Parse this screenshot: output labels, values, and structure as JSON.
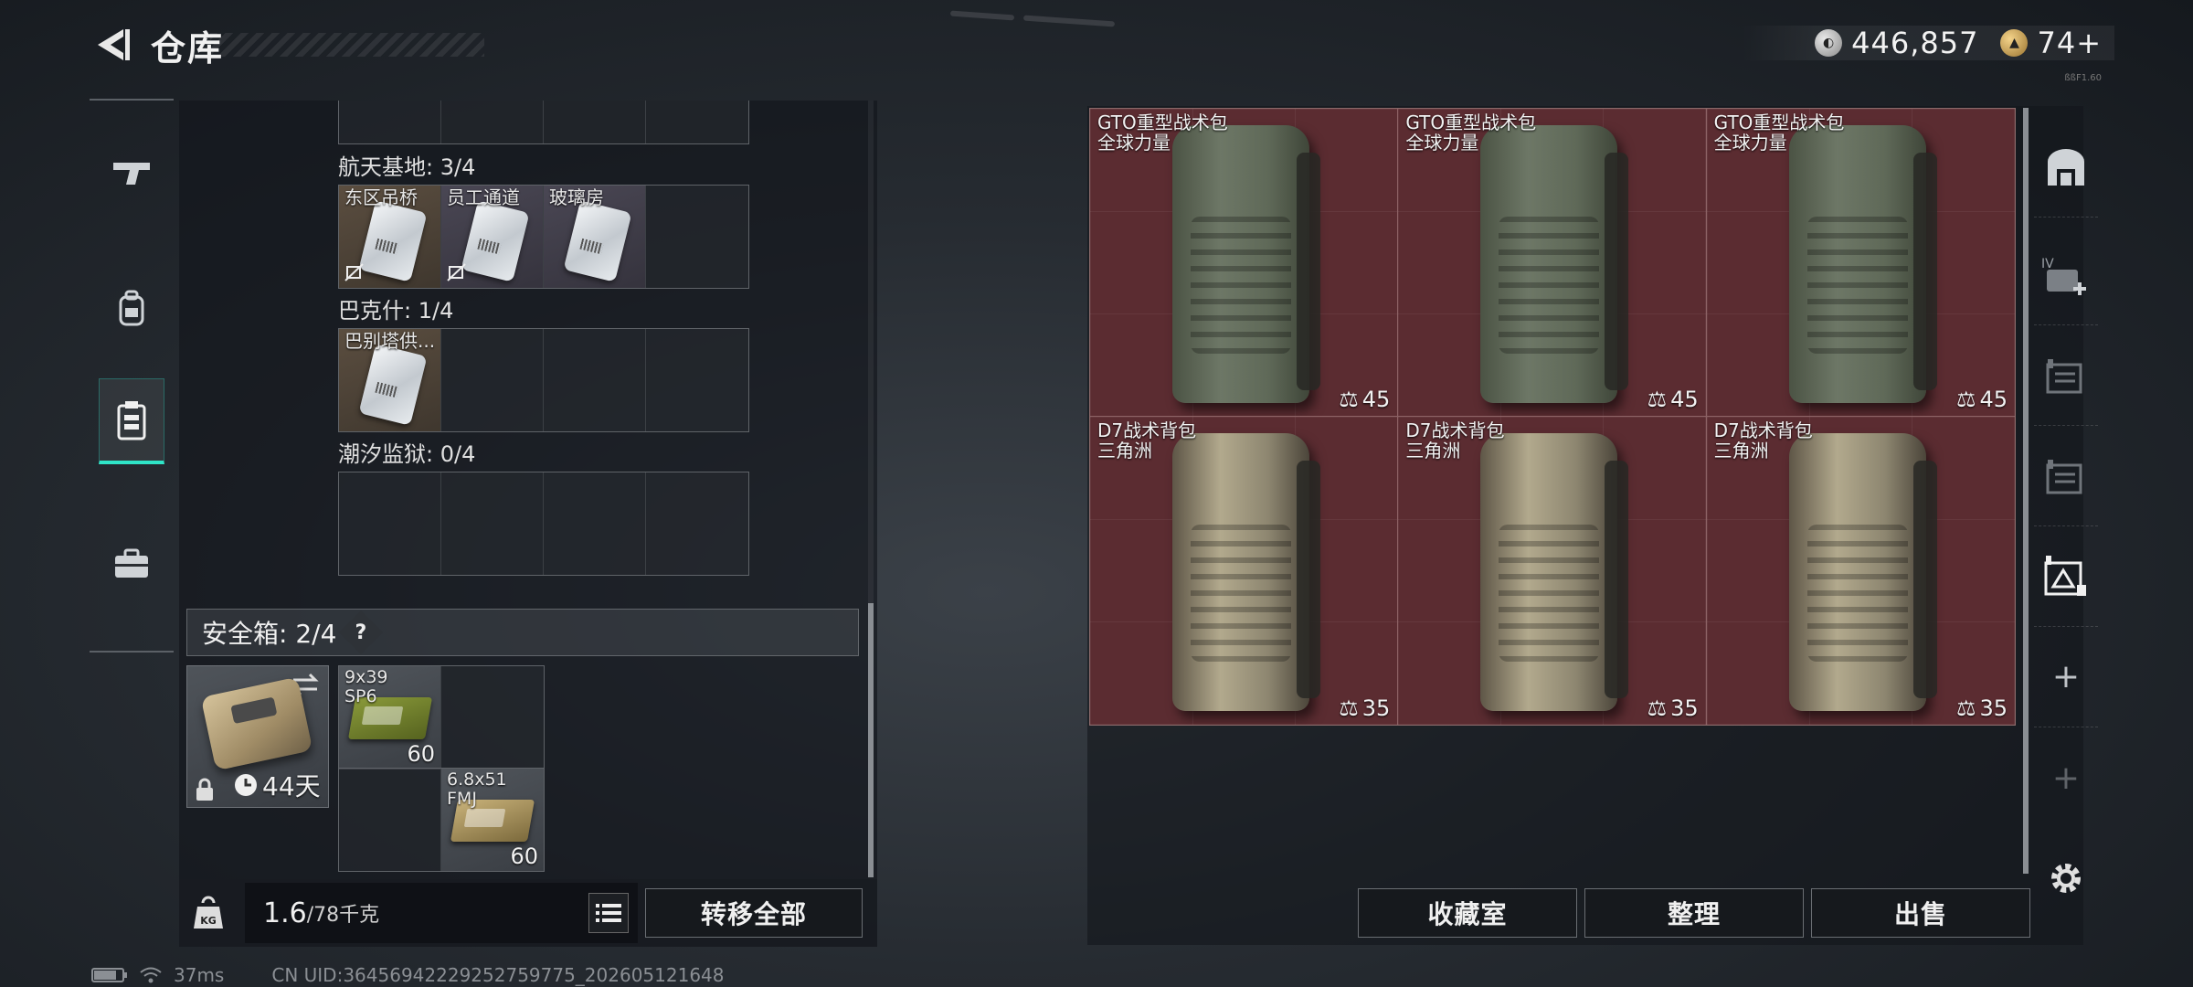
{
  "header": {
    "title": "仓库",
    "currency_primary": "446,857",
    "currency_secondary": "74+",
    "tiny_label": "ßßF1.60"
  },
  "left_nav": {
    "items": [
      {
        "icon": "gun-icon"
      },
      {
        "icon": "backpack-icon"
      },
      {
        "icon": "vest-icon",
        "active": true
      },
      {
        "icon": "briefcase-icon"
      }
    ]
  },
  "keys": {
    "sections": [
      {
        "label": "航天基地: 3/4",
        "cells": [
          "东区吊桥",
          "员工通道",
          "玻璃房",
          ""
        ]
      },
      {
        "label": "巴克什: 1/4",
        "cells": [
          "巴别塔供...",
          "",
          "",
          ""
        ]
      },
      {
        "label": "潮汐监狱: 0/4",
        "cells": [
          "",
          "",
          "",
          ""
        ]
      }
    ]
  },
  "safebox": {
    "label": "安全箱: 2/4",
    "help": "?",
    "duration": "44天",
    "items": [
      {
        "name": "9x39\nSP6",
        "qty": "60"
      },
      {
        "name": "6.8x51\nFMJ",
        "qty": "60"
      }
    ]
  },
  "bottom_left": {
    "weight_current": "1.6",
    "weight_max": "/78千克",
    "transfer_all": "转移全部",
    "weight_icon_text": "KG"
  },
  "backpacks": [
    {
      "name": "GTO重型战术包",
      "faction": "全球力量",
      "weight": "45",
      "color": "gto"
    },
    {
      "name": "GTO重型战术包",
      "faction": "全球力量",
      "weight": "45",
      "color": "gto"
    },
    {
      "name": "GTO重型战术包",
      "faction": "全球力量",
      "weight": "45",
      "color": "gto"
    },
    {
      "name": "D7战术背包",
      "faction": "三角洲",
      "weight": "35",
      "color": "d7"
    },
    {
      "name": "D7战术背包",
      "faction": "三角洲",
      "weight": "35",
      "color": "d7"
    },
    {
      "name": "D7战术背包",
      "faction": "三角洲",
      "weight": "35",
      "color": "d7"
    }
  ],
  "right_buttons": {
    "collection": "收藏室",
    "organize": "整理",
    "sell": "出售"
  },
  "status": {
    "ping": "37ms",
    "uid": "CN UID:36456942229252759775_202605121648"
  },
  "colors": {
    "accent": "#2fe4c7",
    "item_red": "#5b2c31"
  }
}
